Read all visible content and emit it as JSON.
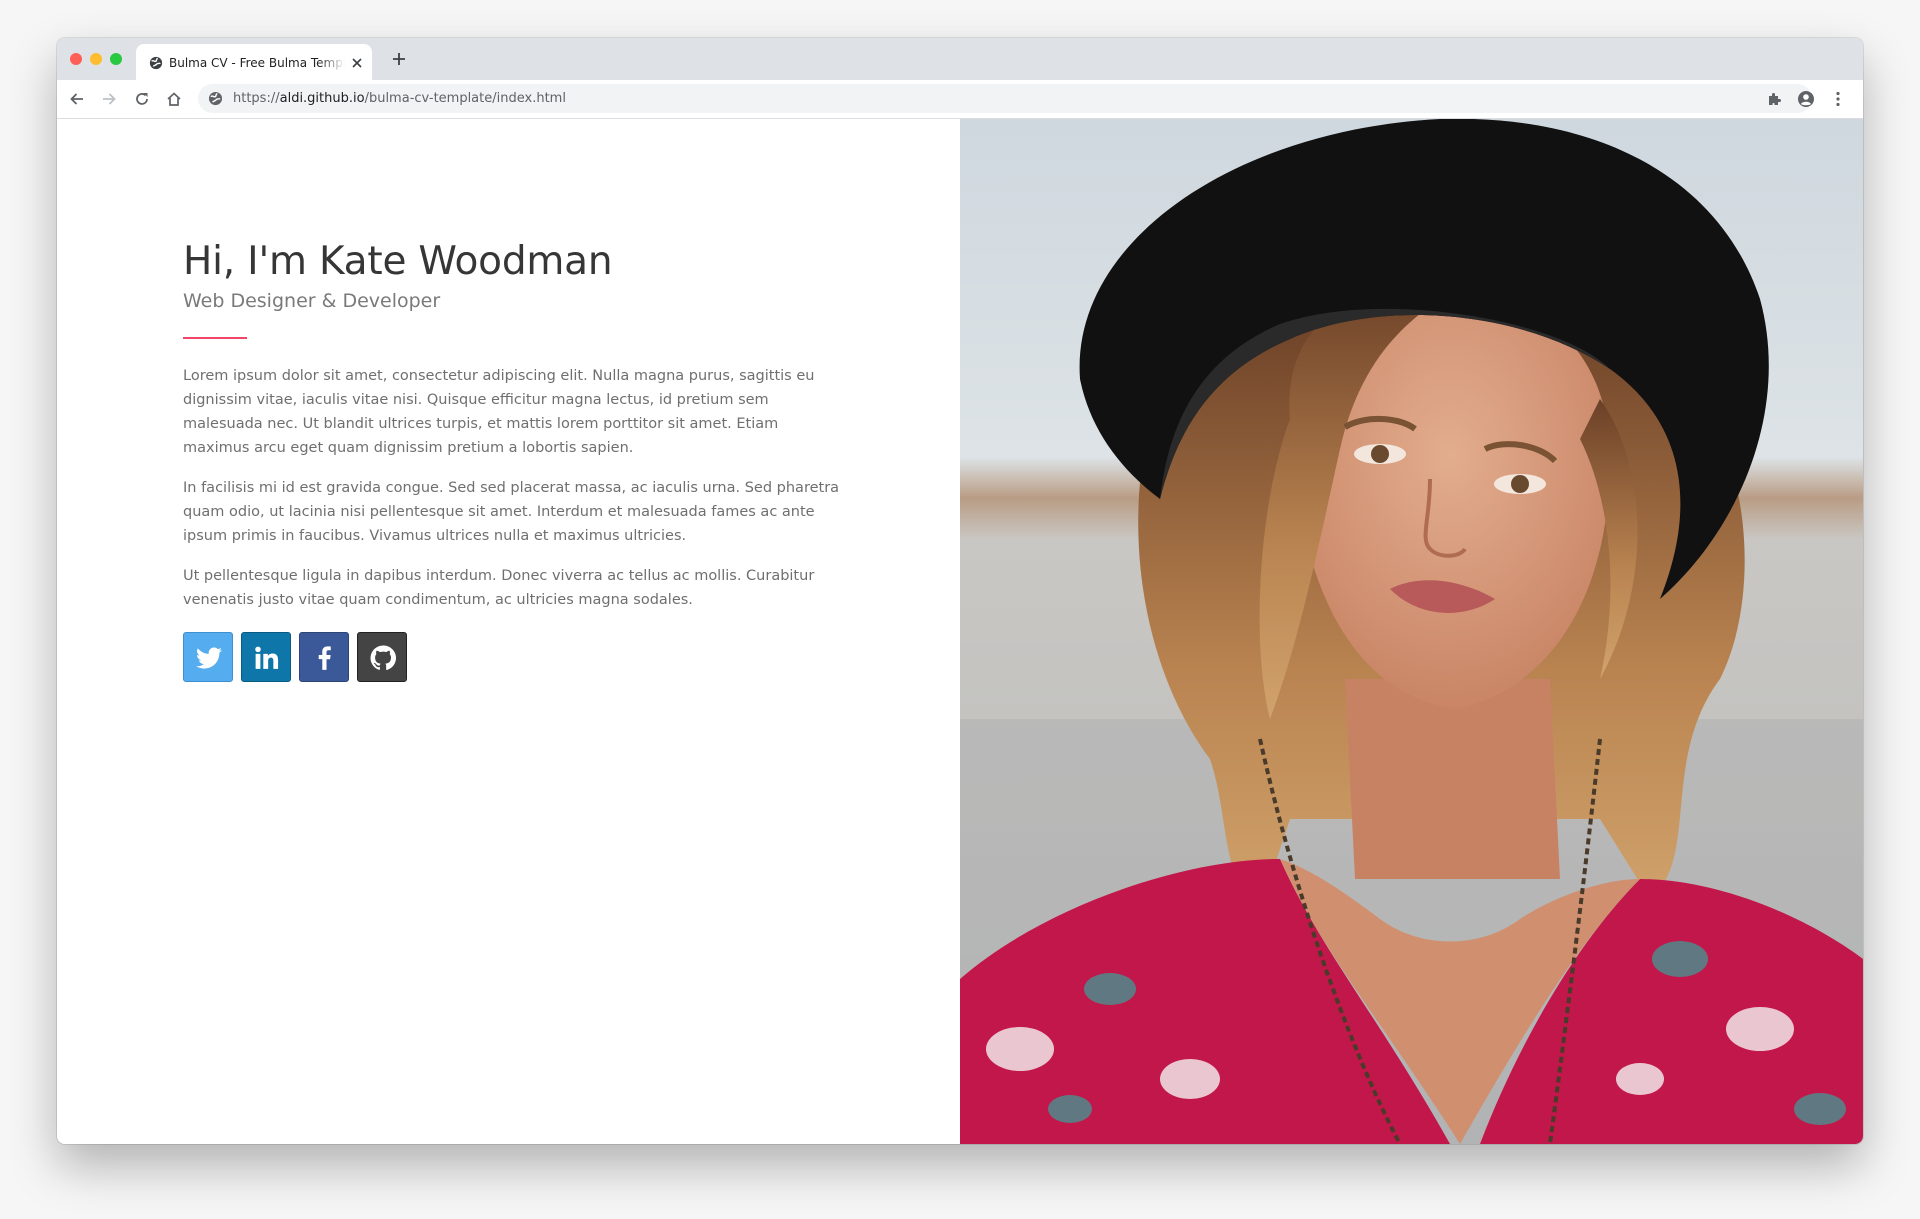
{
  "browser": {
    "tab": {
      "title": "Bulma CV - Free Bulma Template"
    },
    "address_bar": {
      "scheme": "https://",
      "host": "aldi.github.io",
      "path": "/bulma-cv-template/index.html"
    },
    "icons": {
      "tab_favicon": "globe-icon",
      "tab_close": "close-icon",
      "new_tab": "plus-icon",
      "back": "arrow-left-icon",
      "forward": "arrow-right-icon",
      "reload": "reload-icon",
      "home": "home-icon",
      "site_info": "site-info-icon",
      "extensions": "puzzle-icon",
      "profile": "account-circle-icon",
      "menu": "kebab-menu-icon"
    }
  },
  "hero": {
    "heading": "Hi, I'm Kate Woodman",
    "subtitle": "Web Designer & Developer",
    "paragraphs": [
      "Lorem ipsum dolor sit amet, consectetur adipiscing elit. Nulla magna purus, sagittis eu dignissim vitae, iaculis vitae nisi. Quisque efficitur magna lectus, id pretium sem malesuada nec. Ut blandit ultrices turpis, et mattis lorem porttitor sit amet. Etiam maximus arcu eget quam dignissim pretium a lobortis sapien.",
      "In facilisis mi id est gravida congue. Sed sed placerat massa, ac iaculis urna. Sed pharetra quam odio, ut lacinia nisi pellentesque sit amet. Interdum et malesuada fames ac ante ipsum primis in faucibus. Vivamus ultrices nulla et maximus ultricies.",
      "Ut pellentesque ligula in dapibus interdum. Donec viverra ac tellus ac mollis. Curabitur venenatis justo vitae quam condimentum, ac ultricies magna sodales."
    ],
    "social": [
      {
        "icon": "twitter-icon",
        "color": "#55acee"
      },
      {
        "icon": "linkedin-icon",
        "color": "#0e76a8"
      },
      {
        "icon": "facebook-icon",
        "color": "#3b5998"
      },
      {
        "icon": "github-icon",
        "color": "#444444"
      }
    ],
    "accent_color": "#f14668"
  },
  "portrait": {
    "subject": "portrait photo"
  }
}
